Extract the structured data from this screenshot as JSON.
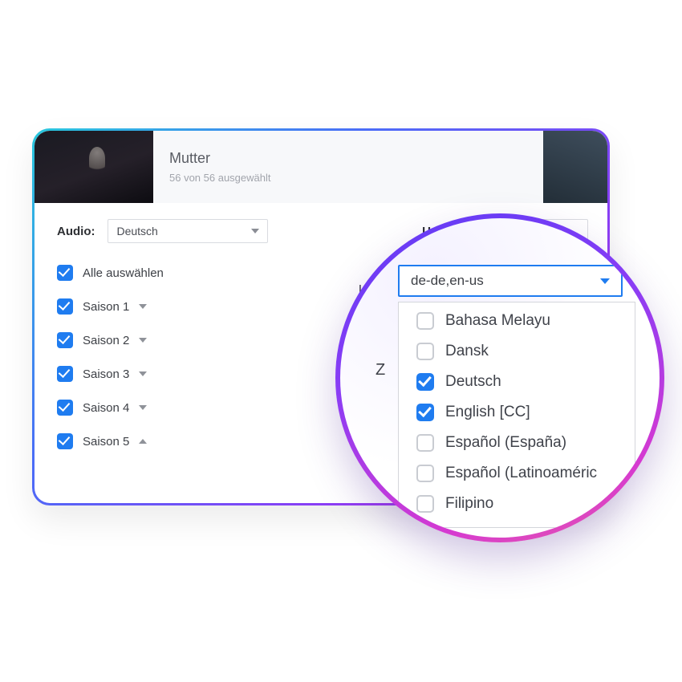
{
  "header": {
    "title": "Mutter",
    "subtitle": "56 von 56 ausgewählt"
  },
  "selectors": {
    "audio_label": "Audio:",
    "audio_value": "Deutsch",
    "subtitle_label": "Untertitel:",
    "subtitle_value": "de-de,en-us"
  },
  "seasons": {
    "select_all": "Alle auswählen",
    "items": [
      {
        "label": "Saison 1",
        "checked": true,
        "expanded": false
      },
      {
        "label": "Saison 2",
        "checked": true,
        "expanded": false
      },
      {
        "label": "Saison 3",
        "checked": true,
        "expanded": false
      },
      {
        "label": "Saison 4",
        "checked": true,
        "expanded": false
      },
      {
        "label": "Saison 5",
        "checked": true,
        "expanded": true
      }
    ]
  },
  "zoom": {
    "field_value": "de-de,en-us",
    "edge_label": "l:",
    "edge_letter": "Z",
    "options": [
      {
        "label": "Bahasa Melayu",
        "checked": false
      },
      {
        "label": "Dansk",
        "checked": false
      },
      {
        "label": "Deutsch",
        "checked": true
      },
      {
        "label": "English [CC]",
        "checked": true
      },
      {
        "label": "Español (España)",
        "checked": false
      },
      {
        "label": "Español (Latinoaméric",
        "checked": false
      },
      {
        "label": "Filipino",
        "checked": false
      }
    ]
  }
}
